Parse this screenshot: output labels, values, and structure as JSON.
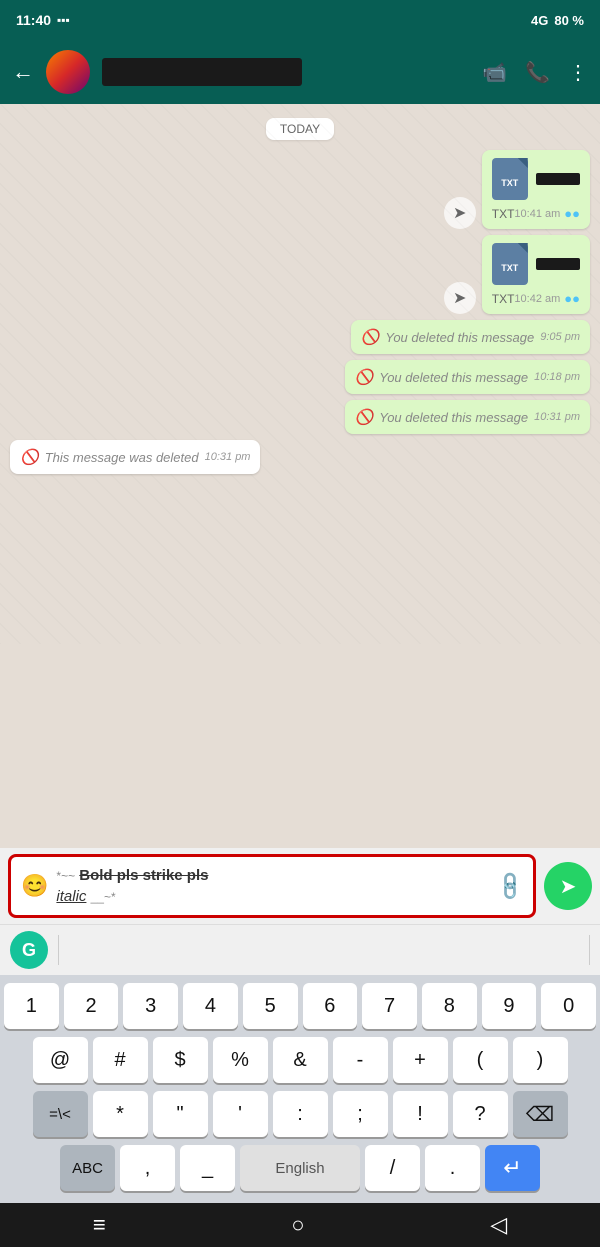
{
  "statusBar": {
    "time": "11:40",
    "signal": "4G",
    "battery": "80 %"
  },
  "header": {
    "backLabel": "←",
    "contactNamePlaceholder": "",
    "videoCallIcon": "📹",
    "phoneIcon": "📞",
    "menuIcon": "⋮"
  },
  "todayLabel": "TODAY",
  "messages": [
    {
      "type": "sent",
      "kind": "file",
      "fileType": "TXT",
      "timestamp": "10:41 am",
      "hasForward": true
    },
    {
      "type": "sent",
      "kind": "file",
      "fileType": "TXT",
      "timestamp": "10:42 am",
      "hasForward": true
    },
    {
      "type": "sent",
      "kind": "deleted",
      "text": "You deleted this message",
      "timestamp": "9:05 pm"
    },
    {
      "type": "sent",
      "kind": "deleted",
      "text": "You deleted this message",
      "timestamp": "10:18 pm"
    },
    {
      "type": "sent",
      "kind": "deleted",
      "text": "You deleted this message",
      "timestamp": "10:31 pm"
    },
    {
      "type": "received",
      "kind": "deleted",
      "text": "This message was deleted",
      "timestamp": "10:31 pm"
    }
  ],
  "inputArea": {
    "emojiIcon": "😊",
    "inputText1": "*~~ Bold pls strike pls",
    "inputText2": "italic __~*",
    "paperclipIcon": "📎",
    "sendIcon": "➤"
  },
  "grammarly": {
    "label": "G"
  },
  "keyboard": {
    "row1": [
      "1",
      "2",
      "3",
      "4",
      "5",
      "6",
      "7",
      "8",
      "9",
      "0"
    ],
    "row2": [
      "@",
      "#",
      "$",
      "%",
      "&",
      "-",
      "+",
      "(",
      ")"
    ],
    "row3": [
      "=\\<",
      "*",
      "\"",
      "'",
      ":",
      ";",
      "!",
      "?",
      "⌫"
    ],
    "row4": [
      "ABC",
      ",",
      "_",
      "English",
      "/",
      ".",
      "↵"
    ]
  },
  "bottomNav": {
    "menuIcon": "≡",
    "homeIcon": "○",
    "backIcon": "◁"
  }
}
